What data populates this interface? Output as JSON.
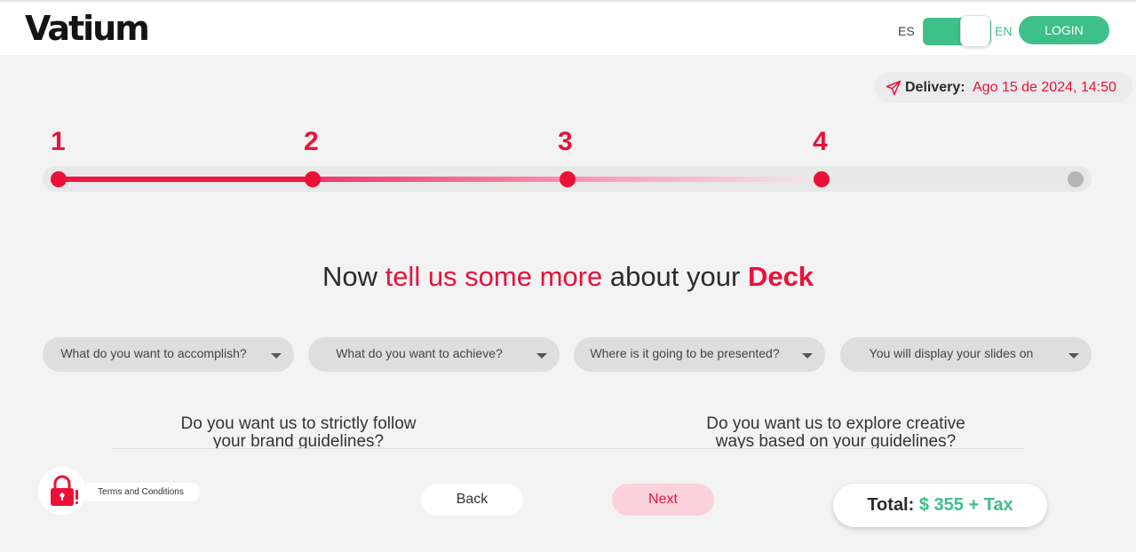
{
  "header": {
    "logo": "Vatium",
    "lang_es": "ES",
    "lang_en": "EN",
    "login_label": "LOGIN"
  },
  "delivery": {
    "label": "Delivery:",
    "date": "Ago 15 de 2024, 14:50"
  },
  "steps": {
    "labels": [
      "1",
      "2",
      "3",
      "4"
    ],
    "current": 4,
    "total_points": 5
  },
  "heading": {
    "part1": "Now ",
    "part2": "tell us some more",
    "part3": " about your ",
    "part4": "Deck"
  },
  "dropdowns": [
    {
      "placeholder": "What do you want to accomplish?"
    },
    {
      "placeholder": "What do you want to achieve?"
    },
    {
      "placeholder": "Where is it going to be presented?"
    },
    {
      "placeholder": "You will display your slides on"
    }
  ],
  "questions": {
    "left": {
      "line1": "Do you want us to strictly follow",
      "line2": "your brand guidelines?"
    },
    "right": {
      "line1": "Do you want us to explore creative",
      "line2": "ways based on your guidelines?"
    }
  },
  "footer": {
    "terms_label": "Terms and Conditions",
    "back_label": "Back",
    "next_label": "Next",
    "total_label": "Total:",
    "total_amount": "$ 355 + Tax"
  },
  "colors": {
    "accent_red": "#e8123c",
    "accent_green": "#3ec08b",
    "background": "#f3f3f3"
  }
}
